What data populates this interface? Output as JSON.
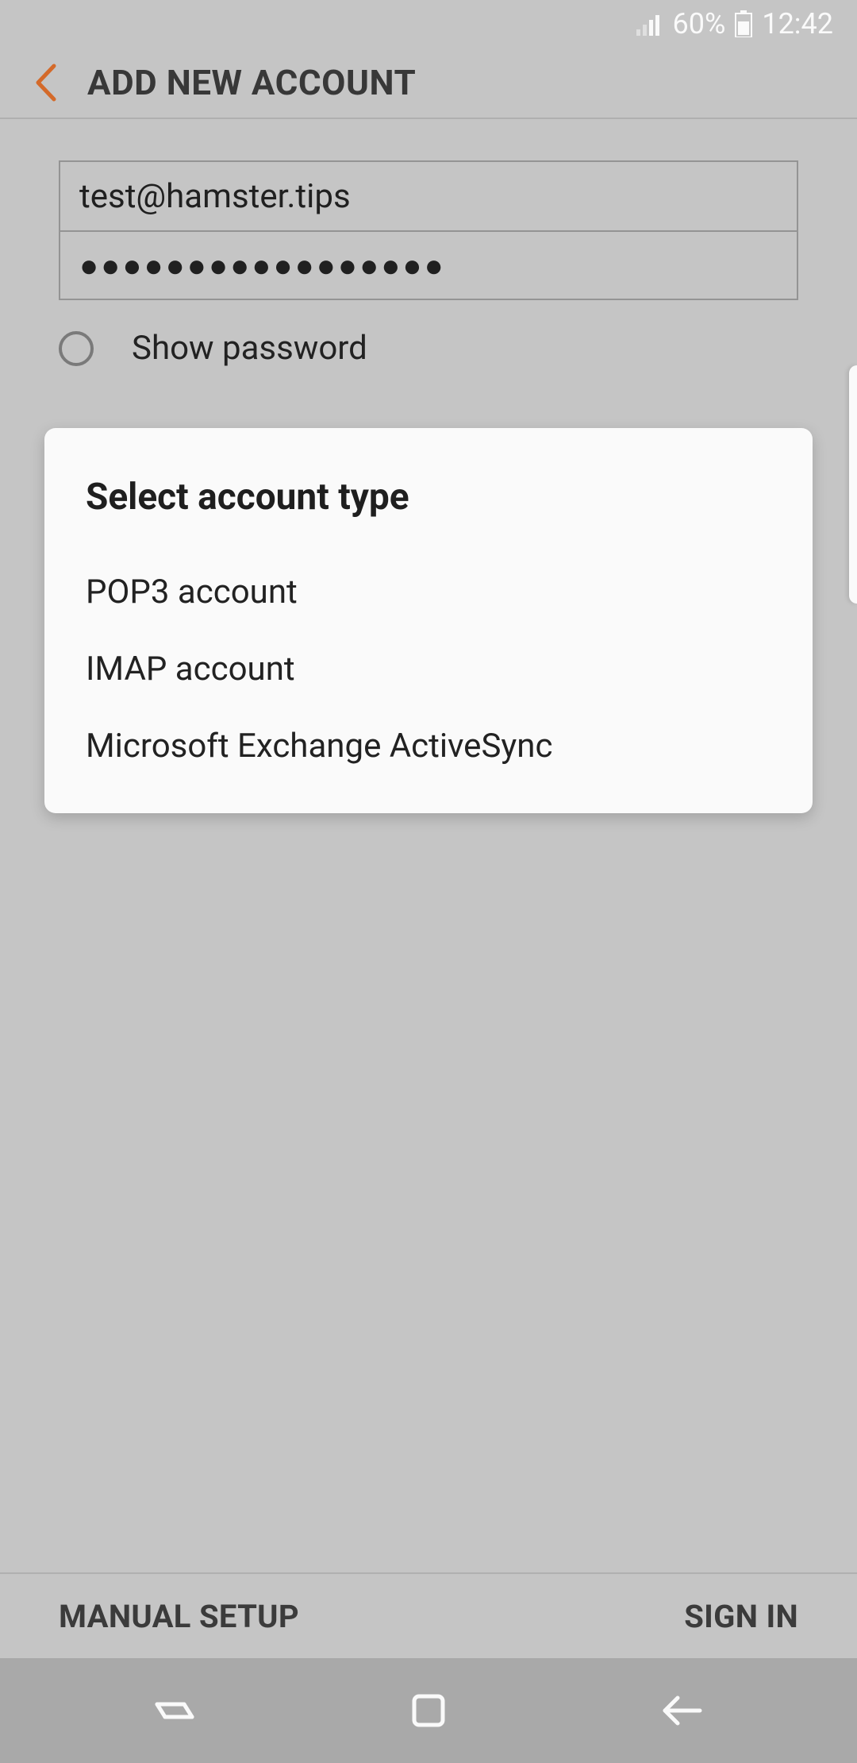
{
  "status_bar": {
    "battery_percent": "60%",
    "time": "12:42"
  },
  "header": {
    "title": "ADD NEW ACCOUNT"
  },
  "form": {
    "email_value": "test@hamster.tips",
    "password_masked": "●●●●●●●●●●●●●●●●●",
    "show_password_label": "Show password",
    "show_password_checked": false
  },
  "dialog": {
    "title": "Select account type",
    "options": [
      "POP3 account",
      "IMAP account",
      "Microsoft Exchange ActiveSync"
    ]
  },
  "bottom_bar": {
    "manual_setup": "MANUAL SETUP",
    "sign_in": "SIGN IN"
  }
}
